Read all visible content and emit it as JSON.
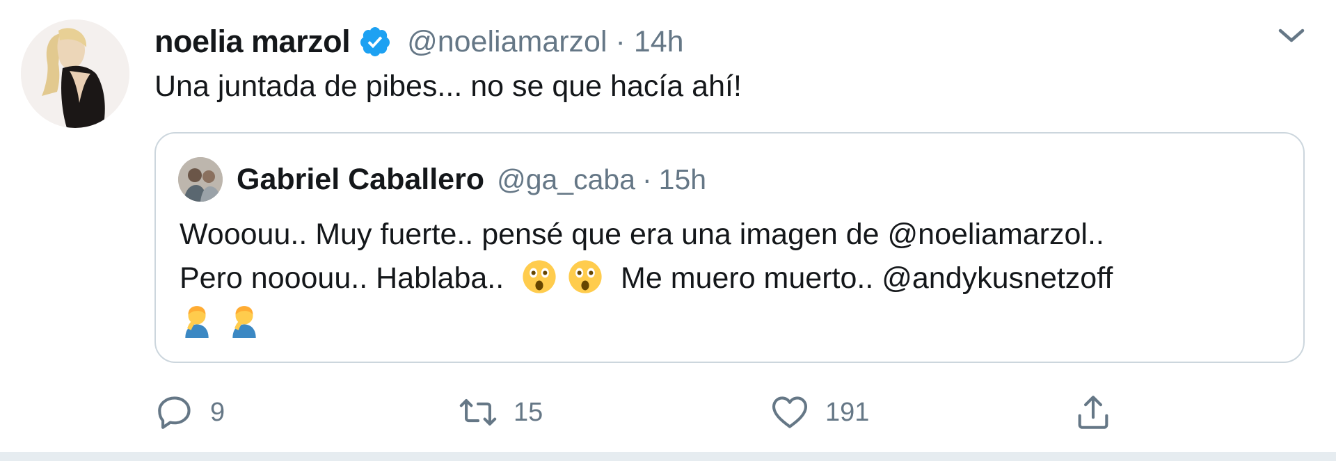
{
  "tweet": {
    "author_name": "noelia marzol",
    "author_handle": "@noeliamarzol",
    "separator": "·",
    "time": "14h",
    "text": "Una juntada de pibes... no se que hacía ahí!",
    "verified": true,
    "menu_icon": "chevron-down-icon",
    "quoted": {
      "author_name": "Gabriel Caballero",
      "author_handle": "@ga_caba",
      "time": "15h",
      "line1": "Wooouu.. Muy fuerte.. pensé que era una imagen de @noeliamarzol..",
      "line2_before_emoji": "Pero nooouu.. Hablaba..",
      "line2_after_emoji": "Me muero muerto.. @andykusnetzoff",
      "emoji_line2": [
        "astonished-face-emoji",
        "astonished-face-emoji"
      ],
      "emoji_line3": [
        "man-facepalming-emoji",
        "man-facepalming-emoji"
      ]
    },
    "actions": {
      "reply": {
        "icon": "reply-icon",
        "count": "9"
      },
      "retweet": {
        "icon": "retweet-icon",
        "count": "15"
      },
      "like": {
        "icon": "heart-icon",
        "count": "191"
      },
      "share": {
        "icon": "share-icon"
      }
    }
  },
  "colors": {
    "text_primary": "#14171a",
    "text_secondary": "#657786",
    "verified_blue": "#1da1f2",
    "border": "#ccd6dd",
    "divider": "#e6ecf0"
  }
}
